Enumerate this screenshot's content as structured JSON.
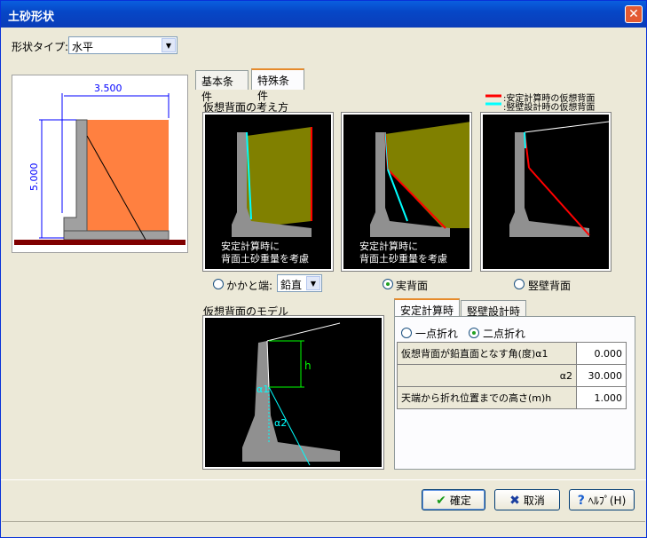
{
  "window": {
    "title": "土砂形状",
    "close_icon": "close-icon"
  },
  "shape_type": {
    "label": "形状タイプ:",
    "value": "水平"
  },
  "preview": {
    "width_dim": "3.500",
    "height_dim": "5.000"
  },
  "tabs": [
    {
      "label": "基本条件"
    },
    {
      "label": "特殊条件"
    }
  ],
  "virtual_back": {
    "heading": "仮想背面の考え方",
    "legend": [
      {
        "label": ":安定計算時の仮想背面",
        "color": "#ff0000"
      },
      {
        "label": ":竪壁設計時の仮想背面",
        "color": "#00ffff"
      }
    ],
    "caption1a": "安定計算時に",
    "caption1b": "背面土砂重量を考慮",
    "caption2a": "安定計算時に",
    "caption2b": "背面土砂重量を考慮",
    "options": [
      {
        "label": "かかと端:",
        "selected": false
      },
      {
        "label": "実背面",
        "selected": true
      },
      {
        "label": "竪壁背面",
        "selected": false
      }
    ],
    "heel_select": "鉛直"
  },
  "model": {
    "heading": "仮想背面のモデル",
    "h": "h",
    "a1": "α1",
    "a2": "α2"
  },
  "sub_tabs": [
    {
      "label": "安定計算時"
    },
    {
      "label": "竪壁設計時"
    }
  ],
  "break_mode": [
    {
      "label": "一点折れ",
      "selected": false
    },
    {
      "label": "二点折れ",
      "selected": true
    }
  ],
  "params": [
    {
      "label": "仮想背面が鉛直面となす角(度)α1",
      "value": "0.000"
    },
    {
      "label": "α2",
      "value": "30.000"
    },
    {
      "label": "天端から折れ位置までの高さ(m)h",
      "value": "1.000"
    }
  ],
  "buttons": {
    "ok": "確定",
    "cancel": "取消",
    "help": "ﾍﾙﾌﾟ(H)"
  }
}
